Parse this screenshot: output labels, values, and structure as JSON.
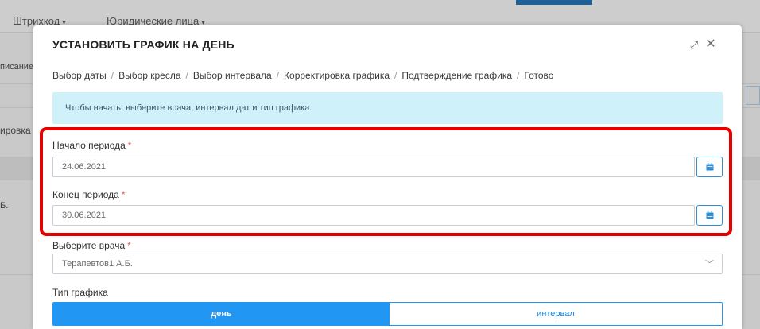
{
  "background": {
    "nav": [
      {
        "label": "Штрихкод",
        "caret": "▾"
      },
      {
        "label": "Юридические лица",
        "caret": "▾"
      }
    ],
    "side_label_1": "писание",
    "side_label_2": "ировка",
    "side_label_3": "Б."
  },
  "modal": {
    "title": "УСТАНОВИТЬ ГРАФИК НА ДЕНЬ",
    "expand_icon": "⤢",
    "close_icon": "✕",
    "breadcrumb": [
      "Выбор даты",
      "Выбор кресла",
      "Выбор интервала",
      "Корректировка графика",
      "Подтверждение графика",
      "Готово"
    ],
    "breadcrumb_separator": "/",
    "alert_text": "Чтобы начать, выберите врача, интервал дат и тип графика.",
    "required_mark": "*",
    "start": {
      "label": "Начало периода",
      "value": "24.06.2021",
      "icon": "calendar-icon"
    },
    "end": {
      "label": "Конец периода",
      "value": "30.06.2021",
      "icon": "calendar-icon"
    },
    "doctor": {
      "label": "Выберите врача",
      "value": "Терапевтов1 А.Б.",
      "chevron": "﹀"
    },
    "schedule_type": {
      "label": "Тип графика",
      "options": [
        "день",
        "интервал"
      ],
      "selected": "день"
    }
  },
  "colors": {
    "accent": "#2196f3",
    "alert_bg": "#cff1f9",
    "highlight": "#e60000",
    "required": "#e05a5a"
  }
}
